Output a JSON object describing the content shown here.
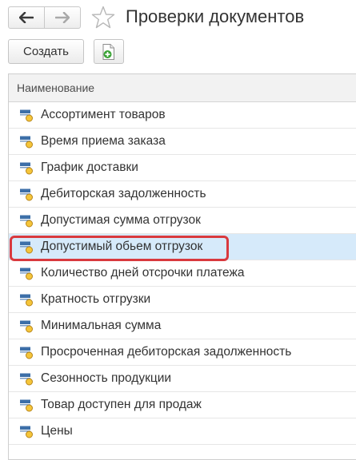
{
  "header": {
    "title": "Проверки документов",
    "back_icon": "arrow-left-icon",
    "forward_icon": "arrow-right-icon",
    "favorite_icon": "star-outline-icon"
  },
  "toolbar": {
    "create_label": "Создать",
    "add_document_icon": "document-add-icon"
  },
  "table": {
    "column_header": "Наименование",
    "row_icon": "attribute-item-icon",
    "selected_index": 5,
    "rows": [
      {
        "label": "Ассортимент товаров"
      },
      {
        "label": "Время приема заказа"
      },
      {
        "label": "График доставки"
      },
      {
        "label": "Дебиторская задолженность"
      },
      {
        "label": "Допустимая сумма отгрузок"
      },
      {
        "label": "Допустимый обьем отгрузок"
      },
      {
        "label": "Количество дней отсрочки платежа"
      },
      {
        "label": "Кратность отгрузки"
      },
      {
        "label": "Минимальная сумма"
      },
      {
        "label": "Просроченная дебиторская задолженность"
      },
      {
        "label": "Сезонность продукции"
      },
      {
        "label": "Товар доступен для продаж"
      },
      {
        "label": "Цены"
      }
    ]
  },
  "colors": {
    "selection_background": "#d6eafa",
    "highlight_border": "#d9393e",
    "icon_blue": "#3d6fa8",
    "icon_yellow": "#f5c53a",
    "doc_add_green": "#3aa335"
  }
}
